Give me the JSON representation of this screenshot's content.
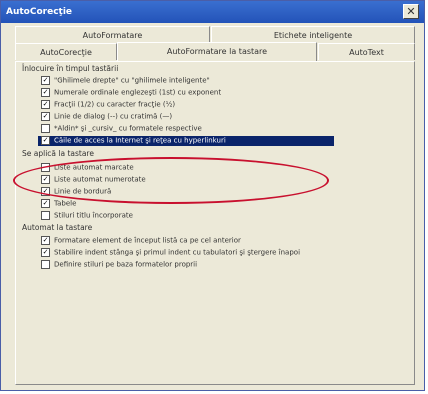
{
  "window": {
    "title": "AutoCorecţie",
    "close_symbol": "✕"
  },
  "tabs_row1": [
    "AutoFormatare",
    "Etichete inteligente"
  ],
  "tabs_row2": [
    "AutoCorecţie",
    "AutoFormatare la tastare",
    "AutoText"
  ],
  "active_tab": "AutoFormatare la tastare",
  "sections": [
    {
      "title": "Înlocuire în timpul tastării",
      "items": [
        {
          "label": "\"Ghilimele drepte\" cu \"ghilimele inteligente\"",
          "checked": true
        },
        {
          "label": "Numerale ordinale englezeşti (1st) cu exponent",
          "checked": true
        },
        {
          "label": "Fracţii (1/2) cu caracter fracţie (½)",
          "checked": true
        },
        {
          "label": "Linie de dialog (--) cu cratimă (—)",
          "checked": true
        },
        {
          "label": "*Aldin* şi _cursiv_ cu formatele respective",
          "checked": false
        },
        {
          "label": "Căile de acces la Internet şi reţea cu hyperlinkuri",
          "checked": true,
          "highlighted": true
        }
      ]
    },
    {
      "title": "Se aplică la tastare",
      "items": [
        {
          "label": "Liste automat marcate",
          "checked": false
        },
        {
          "label": "Liste automat numerotate",
          "checked": true
        },
        {
          "label": "Linie de bordură",
          "checked": true
        },
        {
          "label": "Tabele",
          "checked": true
        },
        {
          "label": "Stiluri titlu încorporate",
          "checked": false
        }
      ]
    },
    {
      "title": "Automat la tastare",
      "items": [
        {
          "label": "Formatare element de început listă ca pe cel anterior",
          "checked": true
        },
        {
          "label": "Stabilire indent stânga şi primul indent cu tabulatori şi ştergere înapoi",
          "checked": true
        },
        {
          "label": "Definire stiluri pe baza formatelor proprii",
          "checked": false
        }
      ]
    }
  ],
  "checkmark_symbol": "✓",
  "colors": {
    "highlight": "#0a246a",
    "annotation": "#c8102e",
    "titlebar": "#2353b8"
  }
}
